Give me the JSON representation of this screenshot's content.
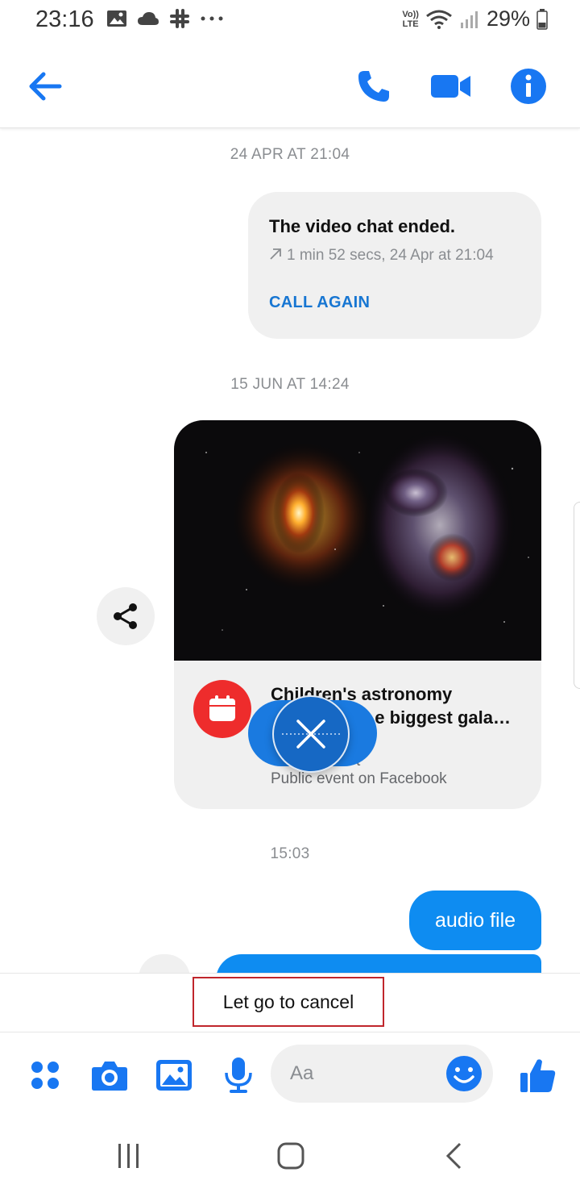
{
  "status_bar": {
    "time": "23:16",
    "battery": "29%",
    "network_label_top": "Vo))",
    "network_label_bottom": "LTE"
  },
  "header": {
    "back_icon": "arrow-left-icon",
    "call_icon": "phone-icon",
    "video_icon": "video-camera-icon",
    "info_icon": "info-icon",
    "accent_color": "#1877f2"
  },
  "messages": {
    "timestamp_1": "24 APR AT 21:04",
    "call": {
      "title": "The video chat ended.",
      "meta": "1 min 52 secs, 24 Apr at 21:04",
      "action": "CALL AGAIN"
    },
    "timestamp_2": "15 JUN AT 14:24",
    "event": {
      "title_line1": "Children's astronomy",
      "title_line2": "e biggest gala…",
      "subtitle_partial": "t",
      "subtitle": "Public event on Facebook"
    },
    "timestamp_3": "15:03",
    "outgoing_text": "audio file",
    "bubble_color": "#0e8cf1"
  },
  "recording": {
    "hint": "Let go to cancel",
    "cancel_icon": "close-icon"
  },
  "composer": {
    "placeholder": "Aa",
    "value": "",
    "icons": [
      "apps-icon",
      "camera-icon",
      "gallery-icon",
      "microphone-icon",
      "emoji-icon",
      "thumbs-up-icon"
    ]
  },
  "nav": {
    "icons": [
      "recents-icon",
      "home-icon",
      "back-icon"
    ]
  }
}
